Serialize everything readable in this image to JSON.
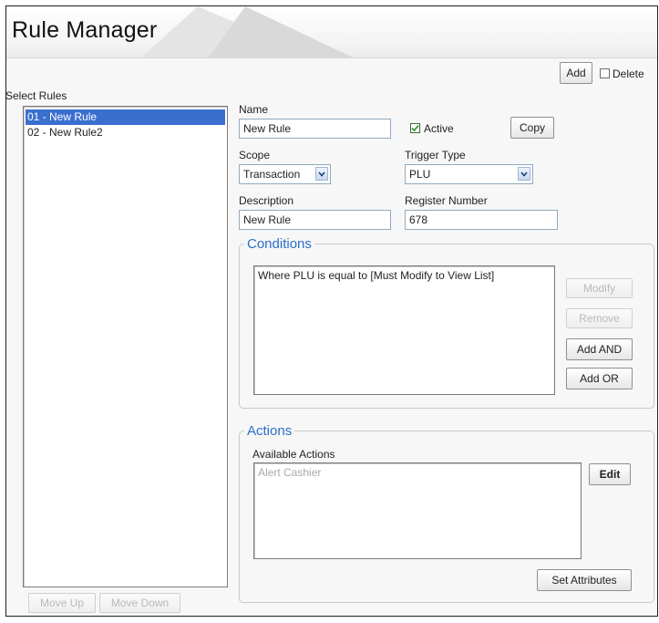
{
  "app": {
    "title": "Rule Manager"
  },
  "toolbar": {
    "add_label": "Add",
    "delete_label": "Delete",
    "delete_checked": false
  },
  "rules_panel": {
    "label": "Select Rules",
    "items": [
      "01 - New Rule",
      "02 - New Rule2"
    ],
    "selected_index": 0,
    "move_up_label": "Move Up",
    "move_down_label": "Move Down"
  },
  "form": {
    "name_label": "Name",
    "name_value": "New Rule",
    "active_label": "Active",
    "active_checked": true,
    "copy_label": "Copy",
    "scope_label": "Scope",
    "scope_value": "Transaction",
    "trigger_type_label": "Trigger Type",
    "trigger_type_value": "PLU",
    "description_label": "Description",
    "description_value": "New Rule",
    "register_number_label": "Register Number",
    "register_number_value": "678"
  },
  "conditions": {
    "title": "Conditions",
    "items": [
      "Where PLU is equal to [Must Modify to View List]"
    ],
    "modify_label": "Modify",
    "remove_label": "Remove",
    "add_and_label": "Add AND",
    "add_or_label": "Add OR"
  },
  "actions": {
    "title": "Actions",
    "available_label": "Available Actions",
    "items": [
      "Alert Cashier"
    ],
    "edit_label": "Edit",
    "set_attributes_label": "Set Attributes"
  },
  "colors": {
    "accent_blue": "#2a6fc9",
    "selection": "#3a6fd0",
    "checkmark": "#2e8b2e"
  },
  "icons": {
    "checkbox_check": "check-icon",
    "dropdown": "chevron-down-icon"
  }
}
